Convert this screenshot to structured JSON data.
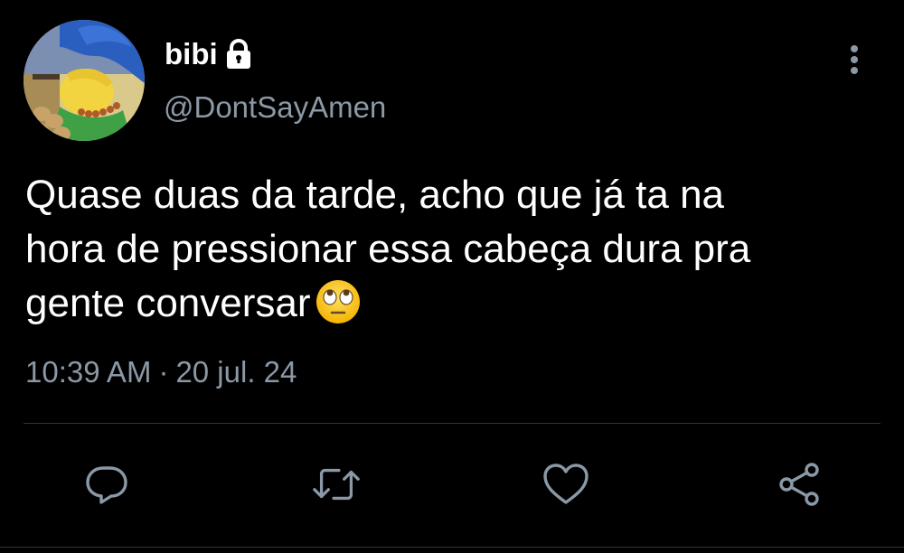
{
  "user": {
    "display_name": "bibi",
    "handle": "@DontSayAmen",
    "protected_icon": "lock-icon",
    "avatar": "avatar-image"
  },
  "tweet": {
    "text": "Quase duas da tarde, acho que já ta na\nhora de pressionar essa cabeça dura pra\ngente conversar",
    "emoji": "face-with-rolling-eyes",
    "time": "10:39 AM",
    "separator": "·",
    "date": "20 jul. 24"
  },
  "actions": [
    {
      "icon": "reply-icon"
    },
    {
      "icon": "retweet-icon"
    },
    {
      "icon": "like-icon"
    },
    {
      "icon": "share-icon"
    }
  ],
  "menu_icon": "more-options-icon",
  "colors": {
    "background": "#000000",
    "text": "#ffffff",
    "secondary": "#8b98a5",
    "divider": "#2f3336"
  }
}
